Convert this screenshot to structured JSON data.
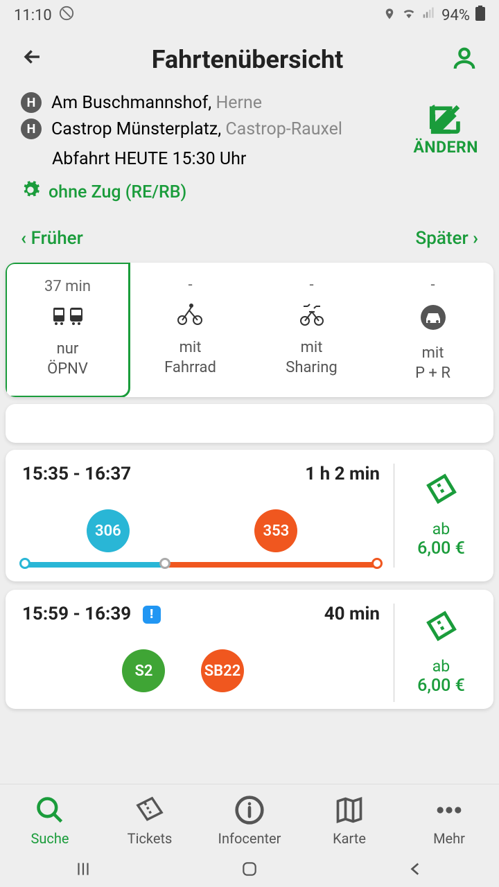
{
  "status": {
    "time": "11:10",
    "battery": "94%"
  },
  "header": {
    "title": "Fahrtenübersicht"
  },
  "route": {
    "from_name": "Am Buschmannshof,",
    "from_city": "Herne",
    "to_name": "Castrop Münsterplatz,",
    "to_city": "Castrop-Rauxel",
    "depart": "Abfahrt HEUTE 15:30 Uhr",
    "edit_label": "ÄNDERN",
    "filter": "ohne Zug (RE/RB)",
    "earlier": "Früher",
    "later": "Später"
  },
  "modes": [
    {
      "time": "37 min",
      "label_line1": "nur",
      "label_line2": "ÖPNV"
    },
    {
      "time": "-",
      "label_line1": "mit",
      "label_line2": "Fahrrad"
    },
    {
      "time": "-",
      "label_line1": "mit",
      "label_line2": "Sharing"
    },
    {
      "time": "-",
      "label_line1": "mit",
      "label_line2": "P + R"
    }
  ],
  "trips": [
    {
      "times": "15:35 - 16:37",
      "duration": "1 h 2 min",
      "alert": false,
      "lines": [
        {
          "label": "306",
          "color": "#29b6d6",
          "pos": 18
        },
        {
          "label": "353",
          "color": "#f0571f",
          "pos": 65
        }
      ],
      "segments": [
        {
          "start": 0,
          "end": 40,
          "color": "#29b6d6"
        },
        {
          "start": 40,
          "end": 100,
          "color": "#f0571f"
        }
      ],
      "price_from": "ab",
      "price": "6,00 €"
    },
    {
      "times": "15:59 - 16:39",
      "duration": "40 min",
      "alert": true,
      "lines": [
        {
          "label": "S2",
          "color": "#3fa535",
          "pos": 28
        },
        {
          "label": "SB22",
          "color": "#f0571f",
          "pos": 50
        }
      ],
      "segments": [],
      "price_from": "ab",
      "price": "6,00 €"
    }
  ],
  "nav": {
    "search": "Suche",
    "tickets": "Tickets",
    "info": "Infocenter",
    "map": "Karte",
    "more": "Mehr"
  },
  "colors": {
    "accent": "#1a9c3b"
  }
}
